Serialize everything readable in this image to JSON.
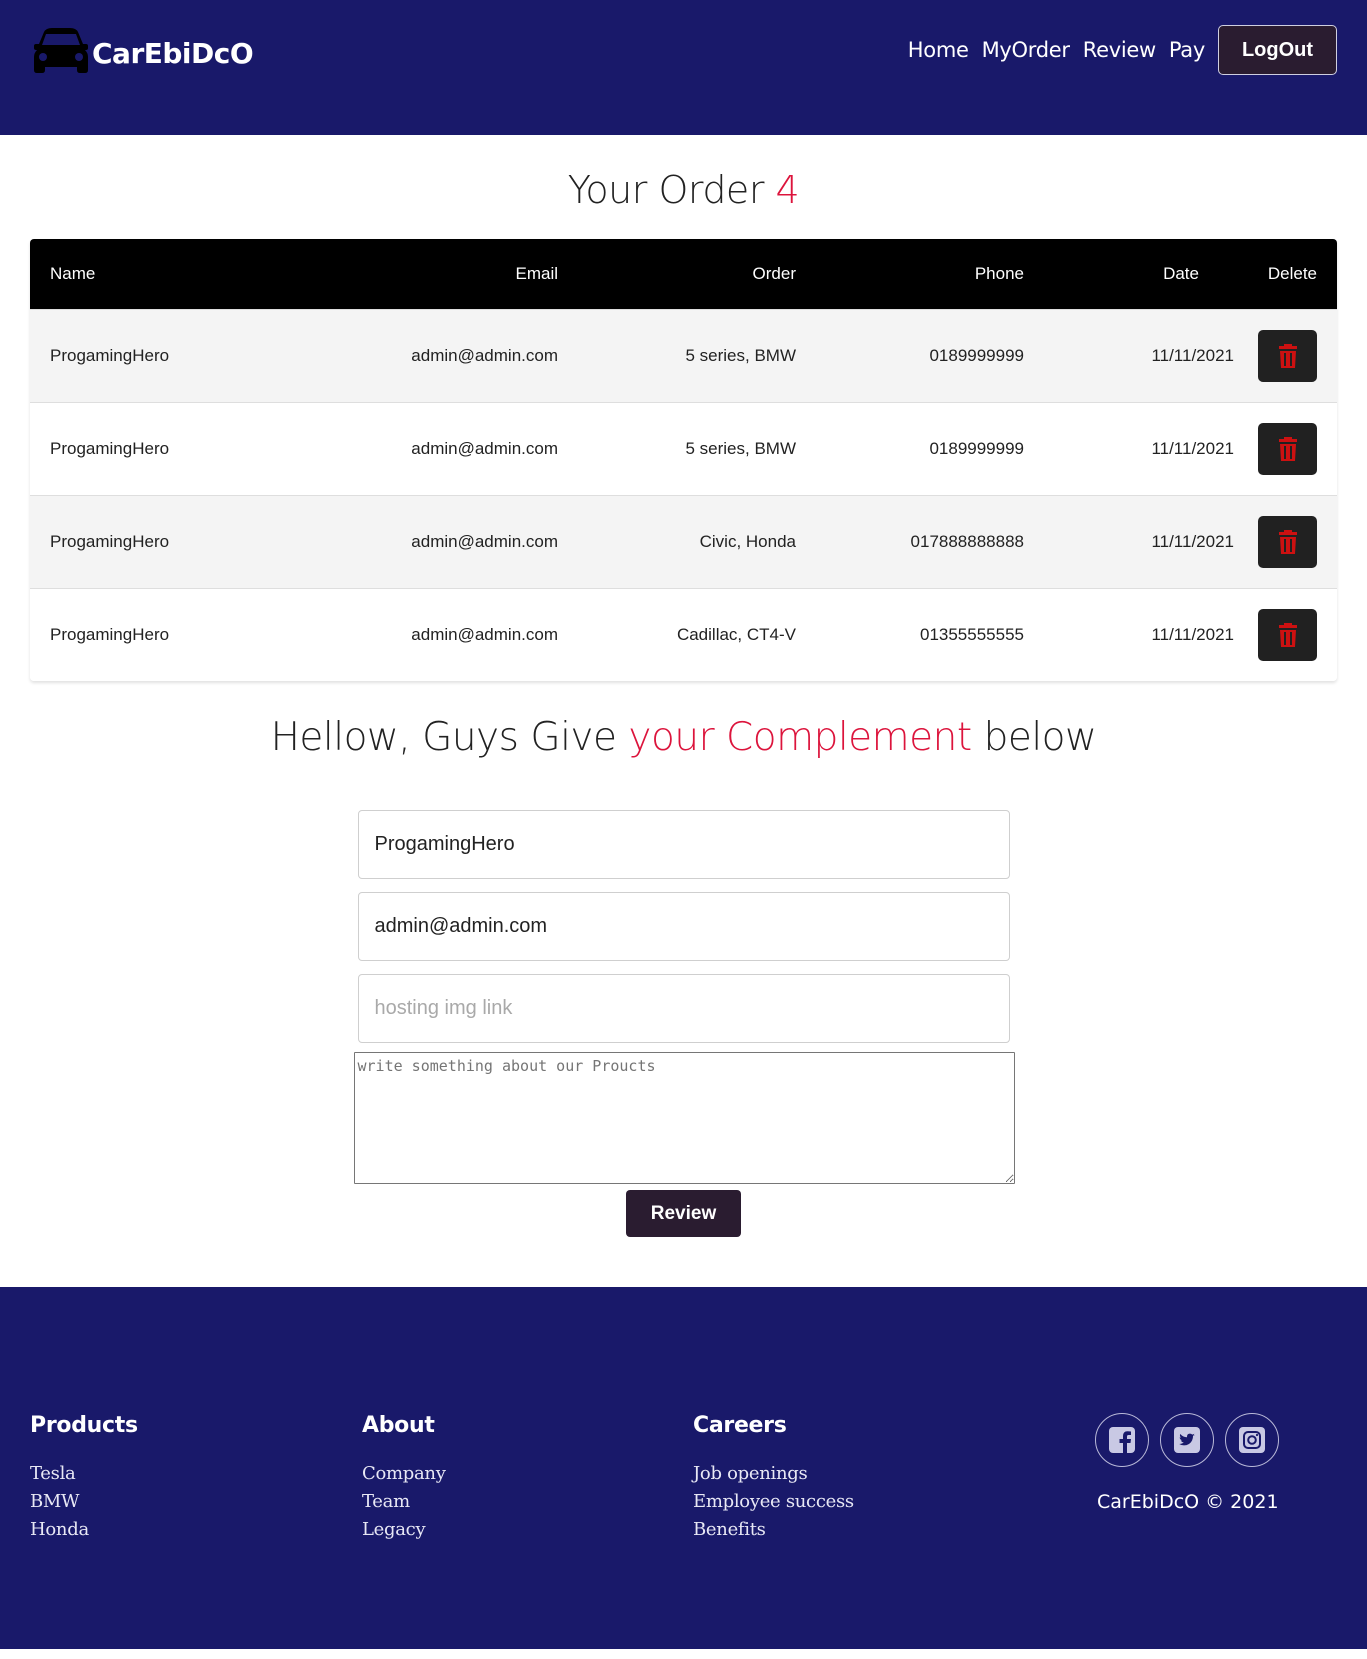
{
  "header": {
    "brand": "CarEbiDcO",
    "nav": [
      "Home",
      "MyOrder",
      "Review",
      "Pay"
    ],
    "logout_label": "LogOut"
  },
  "orders": {
    "title_prefix": "Your Order",
    "count": "4",
    "columns": [
      "Name",
      "Email",
      "Order",
      "Phone",
      "Date",
      "Delete"
    ],
    "rows": [
      {
        "name": "ProgamingHero",
        "email": "admin@admin.com",
        "order": "5 series, BMW",
        "phone": "0189999999",
        "date": "11/11/2021"
      },
      {
        "name": "ProgamingHero",
        "email": "admin@admin.com",
        "order": "5 series, BMW",
        "phone": "0189999999",
        "date": "11/11/2021"
      },
      {
        "name": "ProgamingHero",
        "email": "admin@admin.com",
        "order": "Civic, Honda",
        "phone": "017888888888",
        "date": "11/11/2021"
      },
      {
        "name": "ProgamingHero",
        "email": "admin@admin.com",
        "order": "Cadillac, CT4-V",
        "phone": "01355555555",
        "date": "11/11/2021"
      }
    ],
    "delete_icon": "trash-icon",
    "delete_icon_color": "#cc1111"
  },
  "review": {
    "title_part1": "Hellow, Guys Give",
    "title_highlight": "your Complement",
    "title_part2": "below",
    "name_value": "ProgamingHero",
    "email_value": "admin@admin.com",
    "img_placeholder": "hosting img link",
    "text_placeholder": "write something about our Proucts",
    "submit_label": "Review"
  },
  "footer": {
    "columns": [
      {
        "title": "Products",
        "links": [
          "Tesla",
          "BMW",
          "Honda"
        ]
      },
      {
        "title": "About",
        "links": [
          "Company",
          "Team",
          "Legacy"
        ]
      },
      {
        "title": "Careers",
        "links": [
          "Job openings",
          "Employee success",
          "Benefits"
        ]
      }
    ],
    "social_icons": [
      "facebook-icon",
      "twitter-icon",
      "instagram-icon"
    ],
    "copyright": "CarEbiDcO © 2021"
  },
  "colors": {
    "navy": "#19196a",
    "accent": "#dc143c",
    "button_dark": "#2a1c30"
  }
}
